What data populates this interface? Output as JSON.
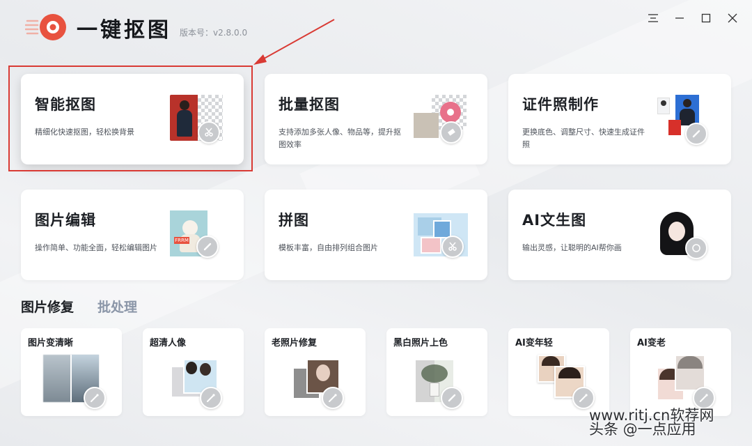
{
  "header": {
    "app_title": "一键抠图",
    "version_label": "版本号：v2.8.0.0"
  },
  "colors": {
    "brand": "#e8523f",
    "annotation": "#d93a34",
    "tab_active": "#1c1f24",
    "tab_inactive": "#8b96a8"
  },
  "window_controls": [
    {
      "name": "menu",
      "icon": "menu-icon"
    },
    {
      "name": "minimize",
      "icon": "minimize-icon"
    },
    {
      "name": "maximize",
      "icon": "maximize-icon"
    },
    {
      "name": "close",
      "icon": "close-icon"
    }
  ],
  "feature_cards": [
    {
      "title": "智能抠图",
      "desc": "精细化快速抠图，轻松换背景",
      "badge_icon": "scissors-icon"
    },
    {
      "title": "批量抠图",
      "desc": "支持添加多张人像、物品等，提升抠图效率",
      "badge_icon": "eraser-icon"
    },
    {
      "title": "证件照制作",
      "desc": "更换底色、调整尺寸、快速生成证件照",
      "badge_icon": "pencil-icon"
    },
    {
      "title": "图片编辑",
      "desc": "操作简单、功能全面，轻松编辑图片",
      "badge_icon": "pencil-icon"
    },
    {
      "title": "拼图",
      "desc": "模板丰富，自由排列组合图片",
      "badge_icon": "scissors-icon"
    },
    {
      "title": "AI文生图",
      "desc": "输出灵感，让聪明的AI帮你画",
      "badge_icon": "palette-icon"
    }
  ],
  "thumb_labels": {
    "editing_tag": "FRRM"
  },
  "tabs": [
    {
      "label": "图片修复",
      "active": true
    },
    {
      "label": "批处理",
      "active": false
    }
  ],
  "repair_cards": [
    {
      "title": "图片变清晰",
      "badge_icon": "wand-icon"
    },
    {
      "title": "超清人像",
      "badge_icon": "wand-icon"
    },
    {
      "title": "老照片修复",
      "badge_icon": "wand-icon"
    },
    {
      "title": "黑白照片上色",
      "badge_icon": "brush-icon"
    },
    {
      "title": "AI变年轻",
      "badge_icon": "wand-icon"
    },
    {
      "title": "AI变老",
      "badge_icon": "wand-icon"
    }
  ],
  "watermark": "头条 @一点应用",
  "watermark_url": "www.ritj.cn软荐网"
}
